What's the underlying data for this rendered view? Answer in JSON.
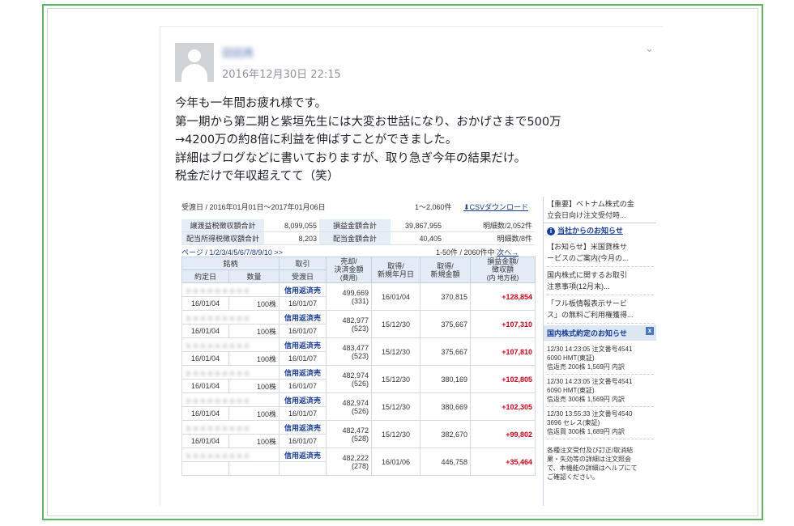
{
  "post": {
    "author": "田田亮",
    "timestamp": "2016年12月30日 22:15",
    "lines": [
      "今年も一年間お疲れ様です。",
      "第一期から第二期と紫垣先生には大変お世話になり、おかげさまで500万",
      "→4200万の約8倍に利益を伸ばすことができました。",
      "詳細はブログなどに書いておりますが、取り急ぎ今年の結果だけ。",
      "税金だけで年収超えてて（笑）"
    ]
  },
  "shot": {
    "range": "受渡日 / 2016年01月01日〜2017年01月06日",
    "count": "1〜2,060件",
    "csv": "CSVダウンロード",
    "summary": [
      {
        "label": "譲渡益税徴収額合計",
        "value": "8,099,055",
        "label2": "損益金額合計",
        "value2": "39,867,955",
        "count": "明細数/2,052件"
      },
      {
        "label": "配当所得税徴収額合計",
        "value": "8,203",
        "label2": "配当金額合計",
        "value2": "40,405",
        "count": "明細数/8件"
      }
    ],
    "pages": "ページ / 1/2/3/4/5/6/7/8/9/10 >>",
    "pageinfo": "1-50件 / 2060件中",
    "next": "次へ→",
    "headers": {
      "meigara": "銘柄",
      "torihiki": "取引",
      "urikyaku": "売却/\n決済金額",
      "urikyaku_sub": "(費用)",
      "shutoku": "取得/\n新規年月日",
      "shutoku_kin": "取得/\n新規金額",
      "soneki": "損益金額/\n徴収額",
      "soneki_sub": "(内 地方税)",
      "yakujo": "約定日",
      "suryo": "数量",
      "ukewatashi": "受渡日"
    },
    "rows": [
      {
        "name": "ｘｘｘｘｘｘｘｘｘ",
        "kind": "信用返済売",
        "amount": "499,669",
        "fee": "(331)",
        "acqdate": "16/01/04",
        "acqamt": "370,815",
        "pl": "+128,854",
        "date": "16/01/04",
        "qty": "100株",
        "settle": "16/01/07"
      },
      {
        "name": "ｘｘｘｘｘｘｘｘｘ",
        "kind": "信用返済売",
        "amount": "482,977",
        "fee": "(523)",
        "acqdate": "15/12/30",
        "acqamt": "375,667",
        "pl": "+107,310",
        "date": "16/01/04",
        "qty": "100株",
        "settle": "16/01/07"
      },
      {
        "name": "ｘｘｘｘｘｘｘｘｘ",
        "kind": "信用返済売",
        "amount": "483,477",
        "fee": "(523)",
        "acqdate": "15/12/30",
        "acqamt": "375,667",
        "pl": "+107,810",
        "date": "16/01/04",
        "qty": "100株",
        "settle": "16/01/07"
      },
      {
        "name": "ｘｘｘｘｘｘｘｘｘ",
        "kind": "信用返済売",
        "amount": "482,974",
        "fee": "(526)",
        "acqdate": "15/12/30",
        "acqamt": "380,169",
        "pl": "+102,805",
        "date": "16/01/04",
        "qty": "100株",
        "settle": "16/01/07"
      },
      {
        "name": "ｘｘｘｘｘｘｘｘｘ",
        "kind": "信用返済売",
        "amount": "482,974",
        "fee": "(526)",
        "acqdate": "15/12/30",
        "acqamt": "380,669",
        "pl": "+102,305",
        "date": "16/01/04",
        "qty": "100株",
        "settle": "16/01/07"
      },
      {
        "name": "ｘｘｘｘｘｘｘｘｘ",
        "kind": "信用返済売",
        "amount": "482,472",
        "fee": "(528)",
        "acqdate": "15/12/30",
        "acqamt": "382,670",
        "pl": "+99,802",
        "date": "16/01/04",
        "qty": "100株",
        "settle": "16/01/07"
      },
      {
        "name": "ｘｘｘｘｘｘｘｘｘ",
        "kind": "信用返済売",
        "amount": "482,222",
        "fee": "(278)",
        "acqdate": "16/01/06",
        "acqamt": "446,758",
        "pl": "+35,464",
        "date": "",
        "qty": "",
        "settle": ""
      }
    ],
    "right": {
      "top1": "【重要】ベトナム株式の金",
      "top2": "立会日向け注文受付時...",
      "notice_title": "当社からのお知らせ",
      "notices": [
        "【お知らせ】米国貸株サ",
        "ービスのご案内(今月の...",
        "国内株式に関するお取引",
        "注意事項(12月末)...",
        "「フル板情報表示サービ",
        "ス」の無料ご利用権獲得..."
      ],
      "exec_title": "国内株式約定のお知らせ",
      "exec": [
        [
          "12/30 14:23:05 注文番号4541",
          "6090 HMT(東証)",
          "信返売 200株 1,569円 内訳"
        ],
        [
          "12/30 14:23:05 注文番号4541",
          "6090 HMT(東証)",
          "信返売 300株 1,569円 内訳"
        ],
        [
          "12/30 13:55:33 注文番号4540",
          "3696 セレス(東証)",
          "信返買 300株 1,689円 内訳"
        ]
      ],
      "foot": [
        "各種注文受付及び訂正/取消結",
        "果・失効等の詳細は注文照会",
        "で、本機能の詳細はヘルプにて",
        "ご確認ください。"
      ]
    }
  }
}
